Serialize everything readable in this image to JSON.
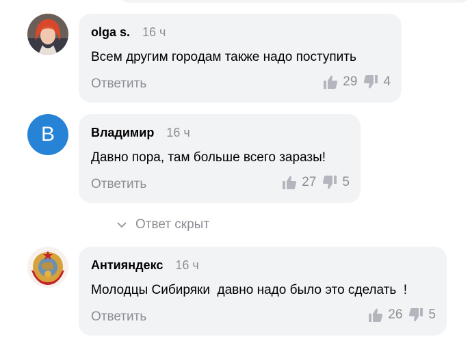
{
  "comments": [
    {
      "author": "olga s.",
      "time": "16 ч",
      "text": "Всем другим городам также надо поступить",
      "reply_label": "Ответить",
      "likes": "29",
      "dislikes": "4"
    },
    {
      "author": "Владимир",
      "avatar_letter": "В",
      "time": "16 ч",
      "text": "Давно пора, там больше всего заразы!",
      "reply_label": "Ответить",
      "likes": "27",
      "dislikes": "5"
    },
    {
      "author": "Антияндекс",
      "time": "16 ч",
      "text": "Молодцы Сибиряки  давно надо было это сделать  !",
      "reply_label": "Ответить",
      "likes": "26",
      "dislikes": "5"
    }
  ],
  "hidden_reply": {
    "label": "Ответ скрыт",
    "icon": "chevron-down-icon"
  },
  "colors": {
    "bubble_bg": "#f2f3f5",
    "muted_text": "#8a8d93",
    "avatar_blue": "#2683d6"
  }
}
